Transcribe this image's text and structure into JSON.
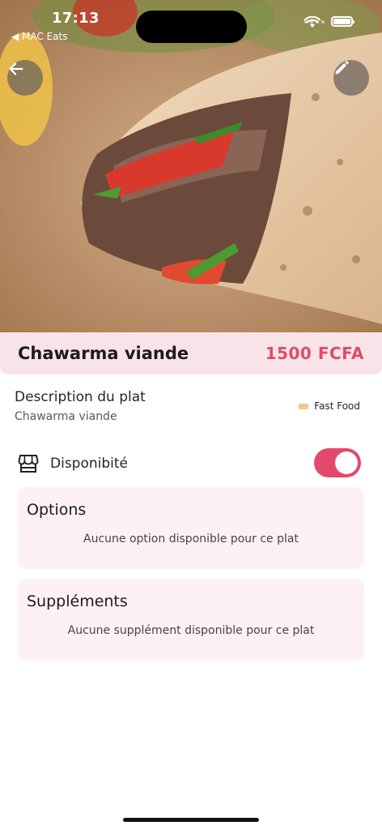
{
  "status_bar": {
    "time": "17:13",
    "back_app": "◀ MAC Eats"
  },
  "dish": {
    "name": "Chawarma viande",
    "price": "1500 FCFA",
    "description_title": "Description du plat",
    "description": "Chawarma viande",
    "category": "Fast Food"
  },
  "availability": {
    "label": "Disponibité",
    "enabled": true
  },
  "options": {
    "title": "Options",
    "empty_text": "Aucune option disponible pour ce plat"
  },
  "supplements": {
    "title": "Suppléments",
    "empty_text": "Aucune supplément disponible pour ce plat"
  },
  "colors": {
    "accent": "#e4486a",
    "price": "#e04b6a",
    "band": "#f8e4e8",
    "card": "#fdf1f3"
  },
  "icons": {
    "back": "arrow-left-icon",
    "edit": "pencil-icon",
    "store": "store-icon"
  }
}
